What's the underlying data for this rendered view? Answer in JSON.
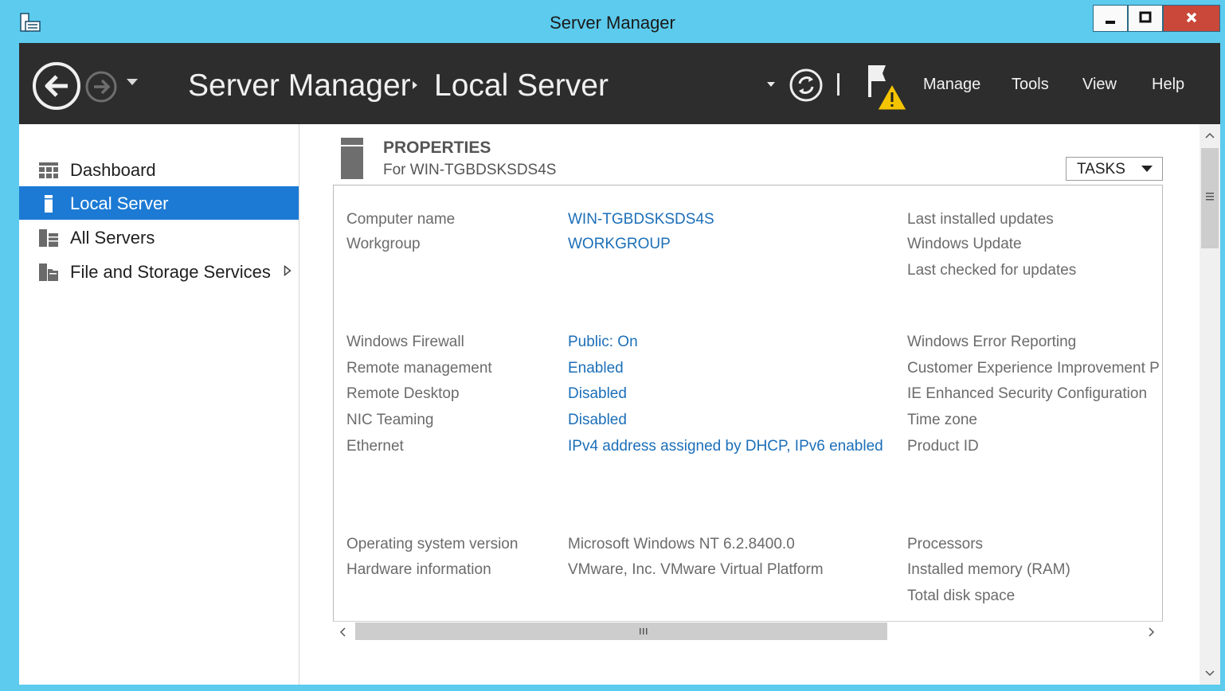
{
  "window": {
    "title": "Server Manager"
  },
  "breadcrumb": {
    "root": "Server Manager",
    "current": "Local Server"
  },
  "menu": {
    "manage": "Manage",
    "tools": "Tools",
    "view": "View",
    "help": "Help"
  },
  "sidebar": {
    "items": [
      {
        "label": "Dashboard"
      },
      {
        "label": "Local Server"
      },
      {
        "label": "All Servers"
      },
      {
        "label": "File and Storage Services"
      }
    ]
  },
  "properties": {
    "title": "PROPERTIES",
    "subtitle": "For WIN-TGBDSKSDS4S",
    "tasks_label": "TASKS",
    "group1": {
      "computer_name_label": "Computer name",
      "computer_name_value": "WIN-TGBDSKSDS4S",
      "workgroup_label": "Workgroup",
      "workgroup_value": "WORKGROUP",
      "last_installed_updates": "Last installed updates",
      "windows_update": "Windows Update",
      "last_checked": "Last checked for updates"
    },
    "group2": {
      "firewall_label": "Windows Firewall",
      "firewall_value": "Public: On",
      "remote_mgmt_label": "Remote management",
      "remote_mgmt_value": "Enabled",
      "remote_desktop_label": "Remote Desktop",
      "remote_desktop_value": "Disabled",
      "nic_teaming_label": "NIC Teaming",
      "nic_teaming_value": "Disabled",
      "ethernet_label": "Ethernet",
      "ethernet_value": "IPv4 address assigned by DHCP, IPv6 enabled",
      "error_reporting": "Windows Error Reporting",
      "ceip": "Customer Experience Improvement P",
      "ie_esc": "IE Enhanced Security Configuration",
      "time_zone": "Time zone",
      "product_id": "Product ID"
    },
    "group3": {
      "os_version_label": "Operating system version",
      "os_version_value": "Microsoft Windows NT 6.2.8400.0",
      "hardware_label": "Hardware information",
      "hardware_value": "VMware, Inc. VMware Virtual Platform",
      "processors": "Processors",
      "installed_memory": "Installed memory (RAM)",
      "total_disk": "Total disk space"
    }
  },
  "colors": {
    "accent": "#1c7ad4",
    "link": "#1c6fb8",
    "header_bg": "#2d2d2d",
    "frame": "#5ccbee",
    "close": "#c9483a",
    "warning": "#f5c400"
  }
}
